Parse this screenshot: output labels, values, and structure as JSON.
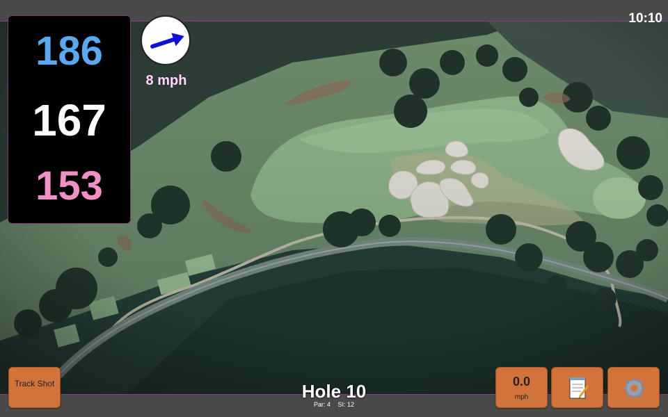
{
  "status_bar": {
    "time": "10:10"
  },
  "distances": {
    "back": "186",
    "middle": "167",
    "front": "153"
  },
  "wind": {
    "speed": "8 mph",
    "icon": "wind-arrow-icon",
    "arrow_color": "#1010dd"
  },
  "buttons": {
    "track_shot": "Track Shot",
    "speed_value": "0.0",
    "speed_unit": "mph",
    "notes_icon": "notepad-icon",
    "settings_icon": "gear-icon"
  },
  "hole": {
    "title": "Hole 10",
    "par": "Par: 4",
    "si": "SI: 12"
  },
  "colors": {
    "back": "#5aa8f0",
    "middle": "#ffffff",
    "front": "#f28fc6",
    "button": "#d2733c",
    "accent_border": "#8a3a8a"
  }
}
